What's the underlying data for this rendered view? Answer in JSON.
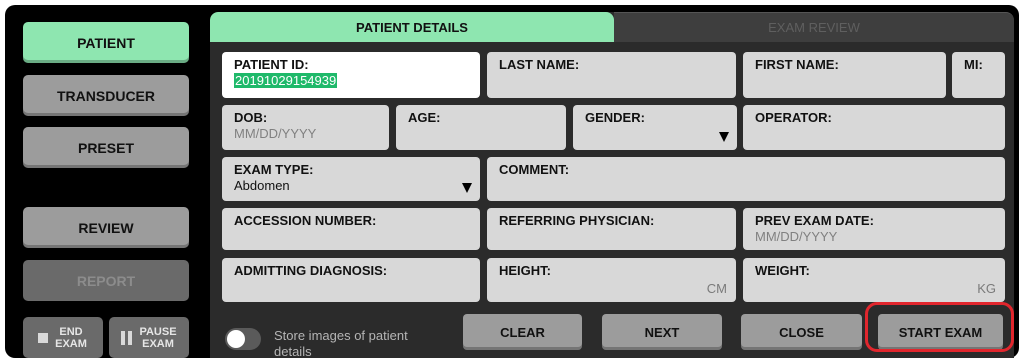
{
  "sidebar": {
    "patient": "PATIENT",
    "transducer": "TRANSDUCER",
    "preset": "PRESET",
    "review": "REVIEW",
    "report": "REPORT",
    "end_exam": "END EXAM",
    "pause_exam": "PAUSE EXAM"
  },
  "tabs": {
    "patient_details": "PATIENT DETAILS",
    "exam_review": "EXAM REVIEW"
  },
  "fields": {
    "patient_id": {
      "label": "PATIENT ID:",
      "value": "20191029154939"
    },
    "last_name": {
      "label": "LAST NAME:"
    },
    "first_name": {
      "label": "FIRST NAME:"
    },
    "mi": {
      "label": "MI:"
    },
    "dob": {
      "label": "DOB:",
      "placeholder": "MM/DD/YYYY"
    },
    "age": {
      "label": "AGE:"
    },
    "gender": {
      "label": "GENDER:"
    },
    "operator": {
      "label": "OPERATOR:"
    },
    "exam_type": {
      "label": "EXAM TYPE:",
      "value": "Abdomen"
    },
    "comment": {
      "label": "COMMENT:"
    },
    "accession_number": {
      "label": "ACCESSION NUMBER:"
    },
    "referring_physician": {
      "label": "REFERRING PHYSICIAN:"
    },
    "prev_exam_date": {
      "label": "PREV EXAM DATE:",
      "placeholder": "MM/DD/YYYY"
    },
    "admitting_diagnosis": {
      "label": "ADMITTING DIAGNOSIS:"
    },
    "height": {
      "label": "HEIGHT:",
      "unit": "CM"
    },
    "weight": {
      "label": "WEIGHT:",
      "unit": "KG"
    }
  },
  "store_images": {
    "label": "Store images of patient details",
    "enabled": false
  },
  "actions": {
    "clear": "CLEAR",
    "next": "NEXT",
    "close": "CLOSE",
    "start_exam": "START EXAM"
  },
  "colors": {
    "active_green": "#8ee6b0",
    "selection_green": "#1fb96a",
    "highlight_red": "#e1262d"
  }
}
